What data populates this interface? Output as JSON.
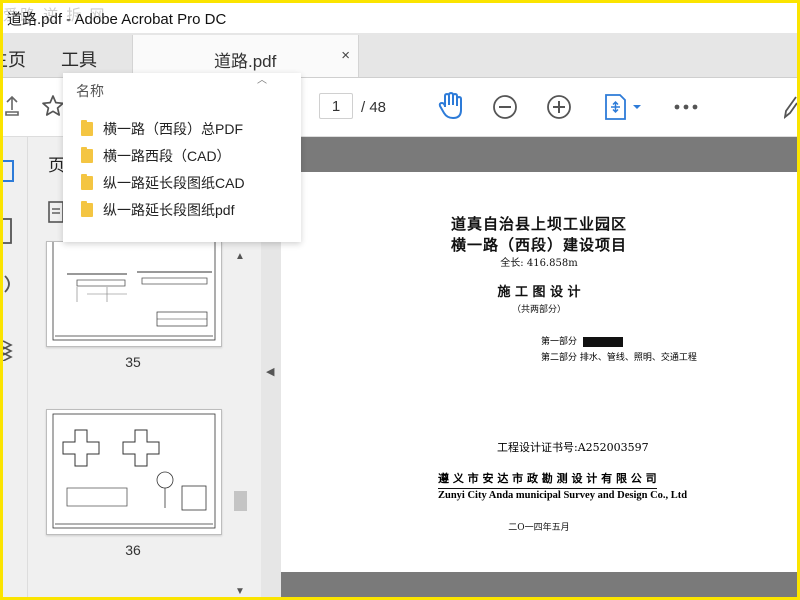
{
  "window": {
    "title": "道路.pdf - Adobe Acrobat Pro DC",
    "watermark": "爱路 逆 拆 网"
  },
  "tabs": {
    "home": "主页",
    "tools": "工具",
    "document": "道路.pdf",
    "close": "×"
  },
  "toolbar": {
    "page_current": "1",
    "page_total": "/ 48",
    "icons": [
      "upload-icon",
      "bookmark-star-icon",
      "hand-tool-icon",
      "zoom-out-icon",
      "zoom-in-icon",
      "page-fit-icon",
      "more-icon",
      "pen-icon"
    ]
  },
  "nav_panel": {
    "label": "页",
    "thumbnails": [
      {
        "number": "35"
      },
      {
        "number": "36"
      }
    ]
  },
  "dropdown": {
    "header": "名称",
    "items": [
      "横一路（西段）总PDF",
      "横一路西段（CAD）",
      "纵一路延长段图纸CAD",
      "纵一路延长段图纸pdf"
    ]
  },
  "document": {
    "title1": "道真自治县上坝工业园区",
    "title2": "横一路（西段）建设项目",
    "length": "全长: 416.858m",
    "heading": "施 工 图 设 计",
    "subheading": "（共两部分）",
    "part1": "第一部分",
    "part2": "第二部分  排水、管线、照明、交通工程",
    "cert": "工程设计证书号:A252003597",
    "company_cn": "遵 义 市 安 达 市 政 勘 测 设 计 有 限 公 司",
    "company_en": "Zunyi City Anda municipal Survey and Design Co., Ltd",
    "date": "二O一四年五月"
  },
  "colors": {
    "frame": "#fbe400",
    "accent": "#2d7bd8",
    "viewer_bg": "#7a7a7a"
  }
}
